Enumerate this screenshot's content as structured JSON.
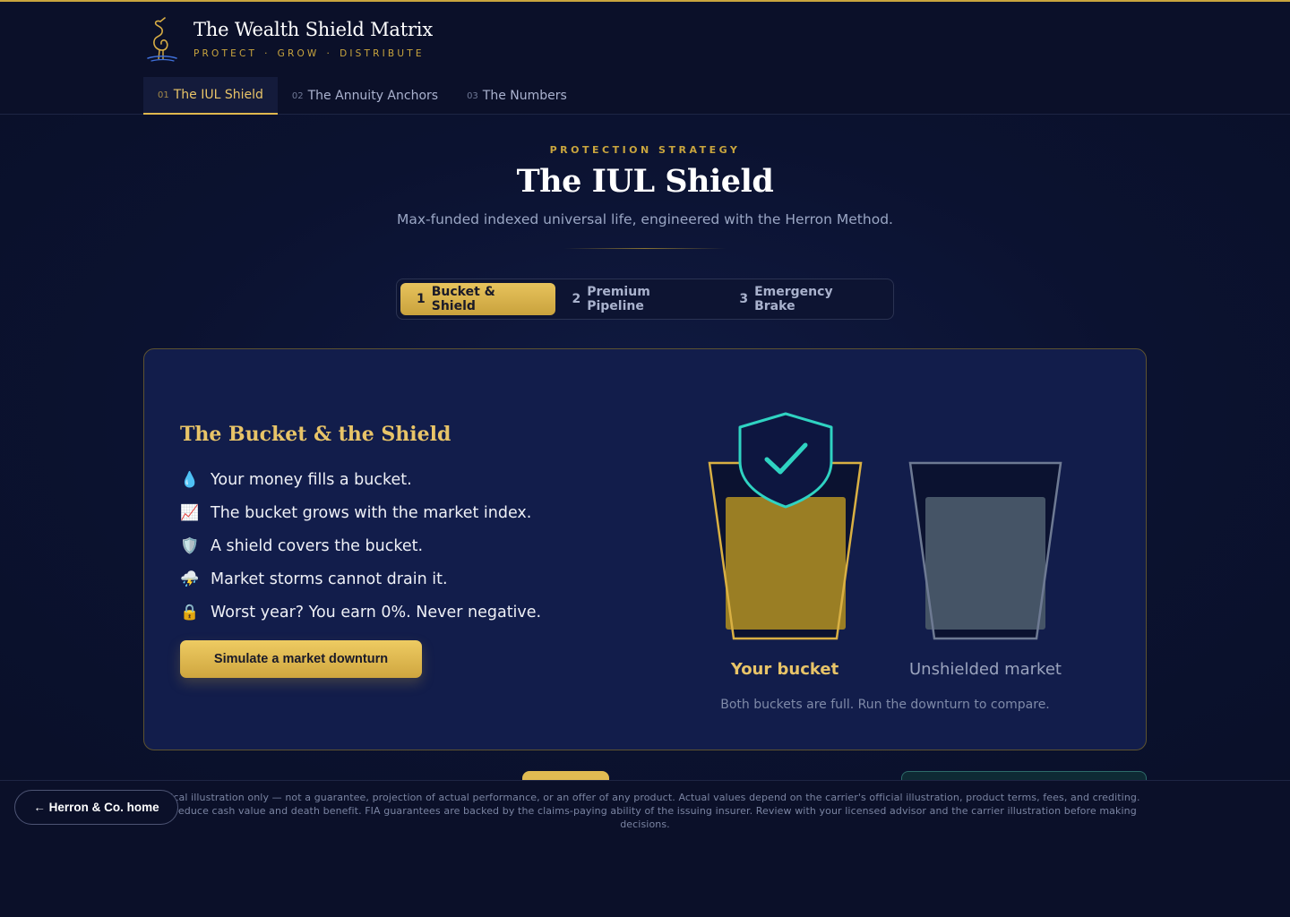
{
  "brand": {
    "title": "The Wealth Shield Matrix",
    "tagline_parts": [
      "PROTECT",
      "GROW",
      "DISTRIBUTE"
    ],
    "separator": "·",
    "logo_icon": "ibis-bird-logo"
  },
  "nav": {
    "tabs": [
      {
        "num": "01",
        "label": "The IUL Shield",
        "active": true
      },
      {
        "num": "02",
        "label": "The Annuity Anchors",
        "active": false
      },
      {
        "num": "03",
        "label": "The Numbers",
        "active": false
      }
    ]
  },
  "hero": {
    "eyebrow": "PROTECTION STRATEGY",
    "title": "The IUL Shield",
    "subtitle": "Max-funded indexed universal life, engineered with the Herron Method."
  },
  "steps": [
    {
      "num": "1",
      "label": "Bucket & Shield",
      "active": true
    },
    {
      "num": "2",
      "label": "Premium Pipeline",
      "active": false
    },
    {
      "num": "3",
      "label": "Emergency Brake",
      "active": false
    }
  ],
  "card": {
    "title": "The Bucket & the Shield",
    "points": [
      {
        "emoji": "💧",
        "icon": "droplet-icon",
        "text": "Your money fills a bucket."
      },
      {
        "emoji": "📈",
        "icon": "chart-up-icon",
        "text": "The bucket grows with the market index."
      },
      {
        "emoji": "🛡️",
        "icon": "shield-icon",
        "text": "A shield covers the bucket."
      },
      {
        "emoji": "⛈️",
        "icon": "storm-icon",
        "text": "Market storms cannot drain it."
      },
      {
        "emoji": "🔒",
        "icon": "lock-icon",
        "text": "Worst year? You earn 0%. Never negative."
      }
    ],
    "cta_label": "Simulate a market downturn",
    "buckets": {
      "your_label": "Your bucket",
      "unshielded_label": "Unshielded market",
      "your_fill_fraction": 1.0,
      "unshielded_fill_fraction": 1.0
    },
    "caption": "Both buckets are full. Run the downturn to compare."
  },
  "footer": {
    "disclaimer": "thetical illustration only — not a guarantee, projection of actual performance, or an offer of any product. Actual values depend on the carrier's official illustration, product terms, fees, and crediting. ans reduce cash value and death benefit. FIA guarantees are backed by the claims-paying ability of the issuing insurer. Review with your licensed advisor and the carrier illustration before making decisions.",
    "home_label": "← Herron & Co. home"
  },
  "colors": {
    "background": "#0b1029",
    "gold": "#e0b84e",
    "teal_shield": "#2fd3c2",
    "card_bg": "#121d4b"
  }
}
